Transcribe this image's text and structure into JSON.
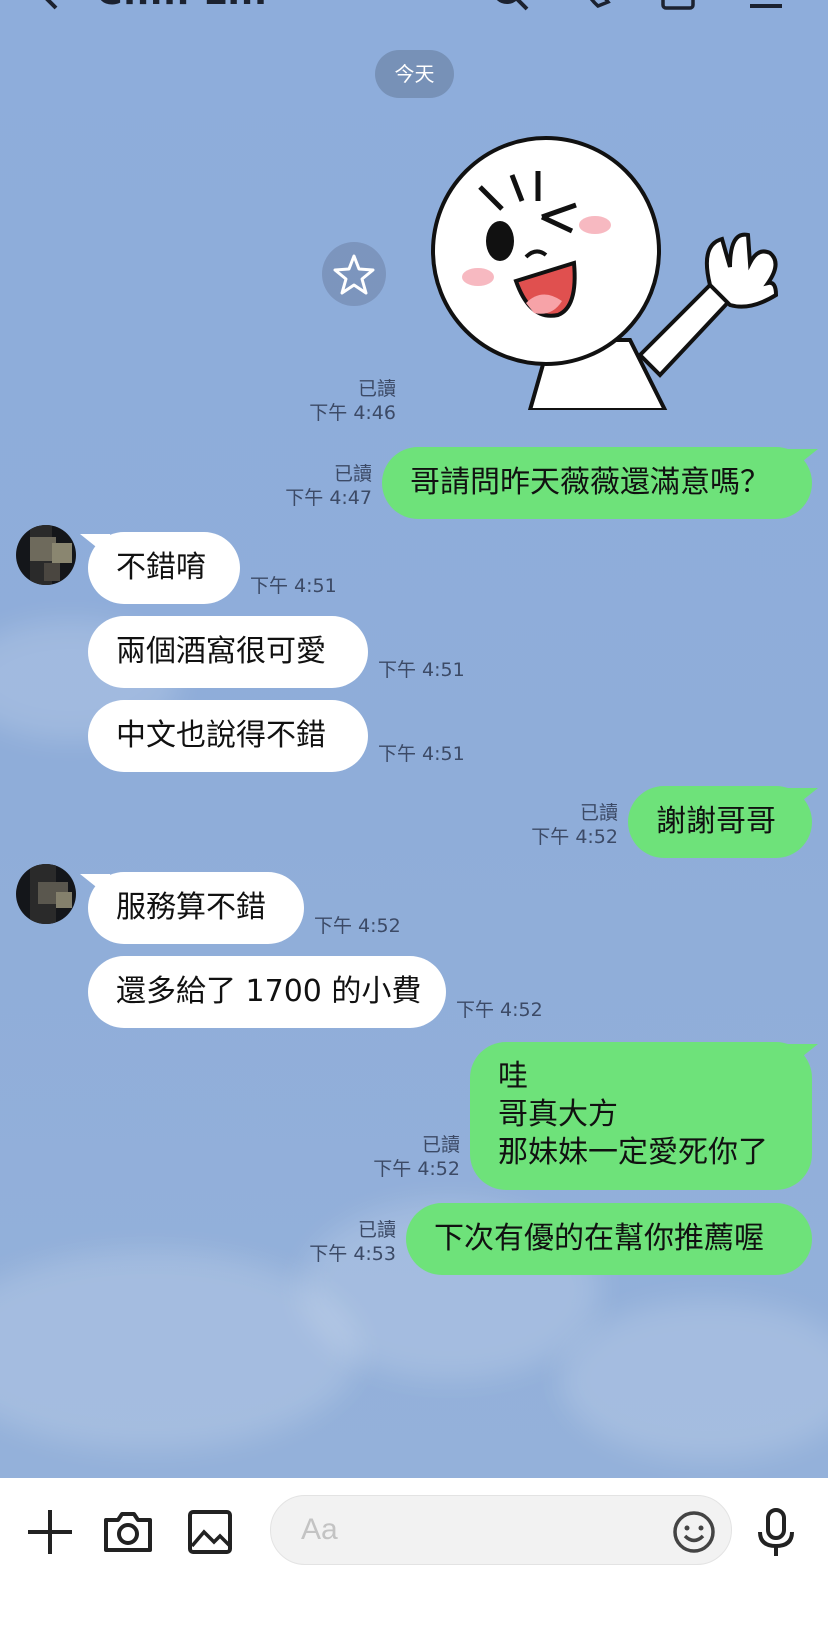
{
  "header": {
    "title": "Chih Lin",
    "icons": [
      "back-arrow-icon",
      "search-icon",
      "phone-icon",
      "notes-icon",
      "menu-icon"
    ]
  },
  "date_separator": "今天",
  "messages": [
    {
      "side": "out",
      "type": "sticker",
      "sticker_name": "waving-face-sticker",
      "read": "已讀",
      "time": "下午 4:46"
    },
    {
      "side": "out",
      "text": "哥請問昨天薇薇還滿意嗎？",
      "read": "已讀",
      "time": "下午 4:47"
    },
    {
      "side": "in",
      "text": "不錯唷",
      "time": "下午 4:51"
    },
    {
      "side": "in",
      "text": "兩個酒窩很可愛",
      "time": "下午 4:51"
    },
    {
      "side": "in",
      "text": "中文也說得不錯",
      "time": "下午 4:51"
    },
    {
      "side": "out",
      "text": "謝謝哥哥",
      "read": "已讀",
      "time": "下午 4:52"
    },
    {
      "side": "in",
      "text": "服務算不錯",
      "time": "下午 4:52"
    },
    {
      "side": "in",
      "text": "還多給了 1700 的小費",
      "time": "下午 4:52"
    },
    {
      "side": "out",
      "lines": [
        "哇",
        "哥真大方",
        "那妹妹一定愛死你了"
      ],
      "read": "已讀",
      "time": "下午 4:52"
    },
    {
      "side": "out",
      "text": "下次有優的在幫你推薦喔",
      "read": "已讀",
      "time": "下午 4:53"
    }
  ],
  "input": {
    "placeholder": "Aa",
    "value": "",
    "icons": [
      "plus-icon",
      "camera-icon",
      "image-icon",
      "emoji-icon",
      "microphone-icon"
    ]
  },
  "colors": {
    "chat_background": "#8facd9",
    "outgoing_bubble": "#6ee27a",
    "incoming_bubble": "#ffffff"
  }
}
